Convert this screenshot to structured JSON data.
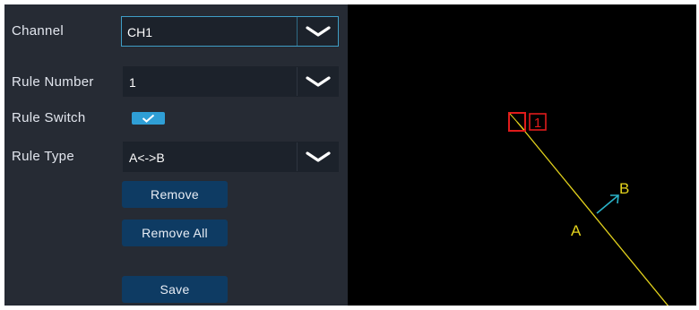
{
  "settings": {
    "channel": {
      "label": "Channel",
      "value": "CH1"
    },
    "rule_number": {
      "label": "Rule Number",
      "value": "1"
    },
    "rule_switch": {
      "label": "Rule Switch",
      "checked": true
    },
    "rule_type": {
      "label": "Rule Type",
      "value": "A<->B"
    },
    "buttons": {
      "remove": "Remove",
      "remove_all": "Remove All",
      "save": "Save"
    }
  },
  "preview": {
    "rule_badge": "1",
    "point_a": "A",
    "point_b": "B",
    "colors": {
      "line": "#e3d21c",
      "marker": "#e01b1b",
      "direction": "#2ab3c9"
    }
  },
  "colors": {
    "panel_bg": "#262b34",
    "field_bg": "#1c222b",
    "accent": "#2f9fd6",
    "button_bg": "#0e3b63"
  }
}
